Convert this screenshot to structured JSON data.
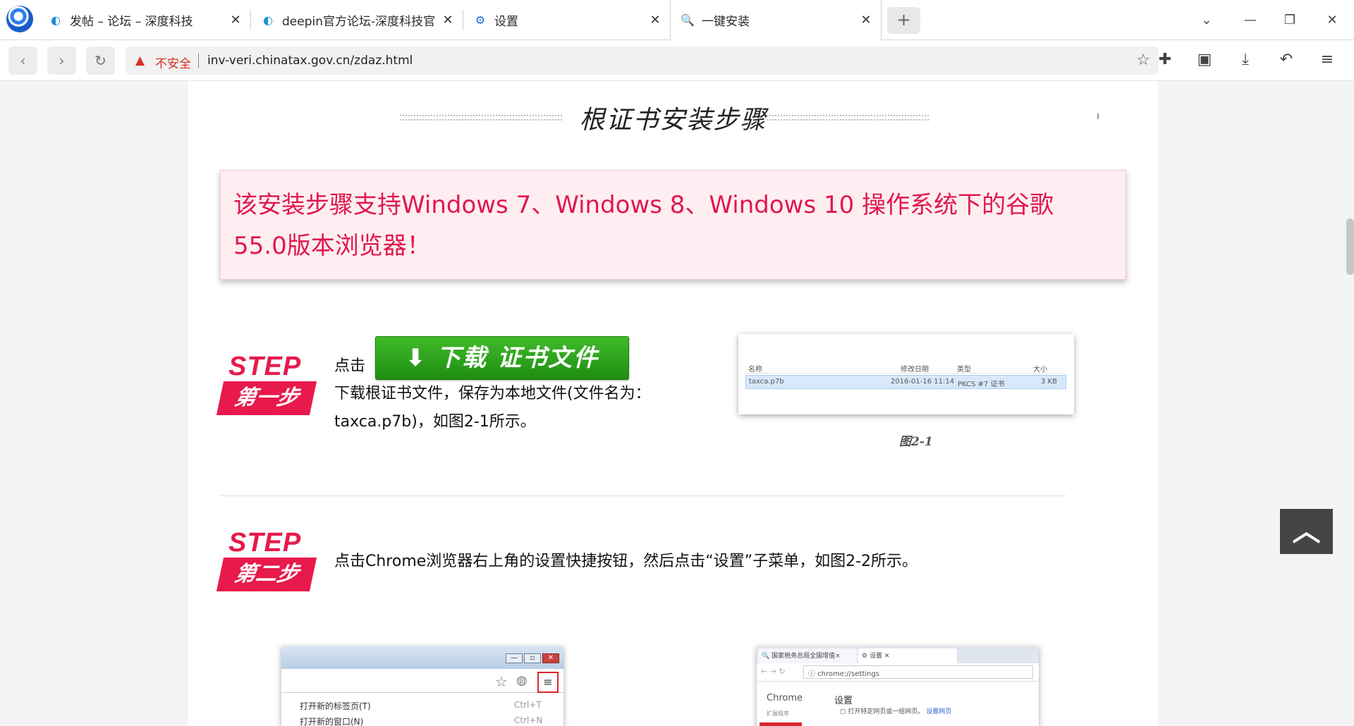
{
  "browser": {
    "tabs": [
      {
        "title": "发帖 – 论坛 – 深度科技",
        "icon": "deepin-icon"
      },
      {
        "title": "deepin官方论坛-深度科技官",
        "icon": "deepin-icon"
      },
      {
        "title": "设置",
        "icon": "gear-icon"
      },
      {
        "title": "一键安装",
        "icon": "search-icon",
        "active": true
      }
    ],
    "insecure_label": "不安全",
    "url": "inv-veri.chinatax.gov.cn/zdaz.html"
  },
  "page": {
    "section_title": "根证书安装步骤",
    "notice": "该安装步骤支持Windows 7、Windows 8、Windows 10 操作系统下的谷歌 55.0版本浏览器！",
    "step1": {
      "badge_en": "STEP 1",
      "badge_cn": "第一步",
      "click_label": "点击",
      "download_button": "下载 证书文件",
      "text": "下载根证书文件，保存为本地文件(文件名为：taxca.p7b)，如图2-1所示。",
      "figure": {
        "headers": [
          "名称",
          "修改日期",
          "类型",
          "大小"
        ],
        "row": [
          "taxca.p7b",
          "2016-01-16 11:14",
          "PKCS #7 证书",
          "3 KB"
        ],
        "caption": "图2-1"
      }
    },
    "step2": {
      "badge_en": "STEP 2",
      "badge_cn": "第二步",
      "text": "点击Chrome浏览器右上角的设置快捷按钮，然后点击“设置”子菜单，如图2-2所示。",
      "figure_left": {
        "menu_items": [
          "打开新的标签页(T)",
          "打开新的窗口(N)"
        ],
        "shortcuts": [
          "Ctrl+T",
          "Ctrl+N"
        ]
      },
      "figure_right": {
        "tab1": "国家税务总局全国增值×",
        "tab2": "设置",
        "address": "chrome://settings",
        "nav_name": "Chrome",
        "settings_title": "设置",
        "ext_label": "扩展程序",
        "option": "打开特定网页或一组网页。",
        "option_link": "设置网页"
      }
    }
  }
}
